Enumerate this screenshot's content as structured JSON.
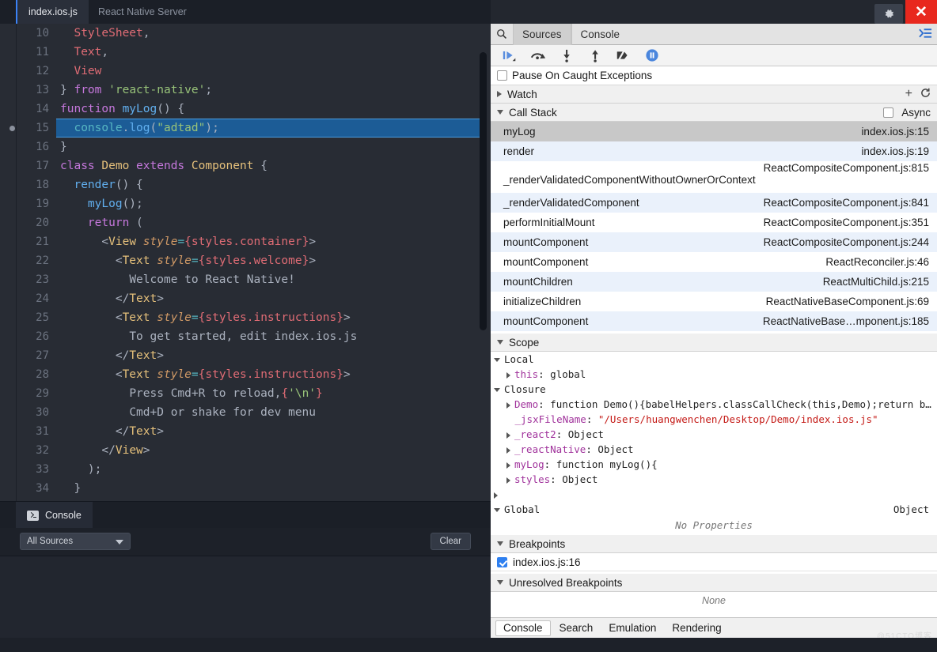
{
  "editor": {
    "tabs": [
      {
        "label": "index.ios.js",
        "active": true
      },
      {
        "label": "React Native Server",
        "active": false
      }
    ],
    "lines": [
      {
        "num": "10",
        "html": "  <span class='t-cls'>StyleSheet</span><span class='t-punc'>,</span>"
      },
      {
        "num": "11",
        "html": "  <span class='t-cls'>Text</span><span class='t-punc'>,</span>"
      },
      {
        "num": "12",
        "html": "  <span class='t-cls'>View</span>"
      },
      {
        "num": "13",
        "html": "<span class='t-punc'>} </span><span class='t-kw'>from</span> <span class='t-str'>'react-native'</span><span class='t-punc'>;</span>"
      },
      {
        "num": "14",
        "html": "<span class='t-kw'>function</span> <span class='t-fn'>myLog</span><span class='t-punc'>() {</span>"
      },
      {
        "num": "15",
        "html": "  <span class='t-obj'>console</span><span class='t-punc'>.</span><span class='t-fn'>log</span><span class='t-punc'>(</span><span class='t-str'>\"adtad\"</span><span class='t-punc'>);</span>",
        "highlight": true,
        "breakpoint": true
      },
      {
        "num": "16",
        "html": "<span class='t-punc'>}</span>"
      },
      {
        "num": "17",
        "html": "<span class='t-kw'>class</span> <span class='t-yellow'>Demo</span> <span class='t-kw'>extends</span> <span class='t-yellow'>Component</span> <span class='t-punc'>{</span>"
      },
      {
        "num": "18",
        "html": "  <span class='t-fn'>render</span><span class='t-punc'>() {</span>"
      },
      {
        "num": "19",
        "html": "    <span class='t-fn'>myLog</span><span class='t-punc'>();</span>"
      },
      {
        "num": "20",
        "html": "    <span class='t-kw'>return</span> <span class='t-punc'>(</span>"
      },
      {
        "num": "21",
        "html": "      <span class='t-punc'>&lt;</span><span class='t-yellow'>View</span> <span class='t-attr'>style</span><span class='t-obj'>=</span><span class='t-brace'>{</span><span class='t-red'>styles</span><span class='t-red'>.container</span><span class='t-brace'>}</span><span class='t-punc'>&gt;</span>"
      },
      {
        "num": "22",
        "html": "        <span class='t-punc'>&lt;</span><span class='t-yellow'>Text</span> <span class='t-attr'>style</span><span class='t-obj'>=</span><span class='t-brace'>{</span><span class='t-red'>styles.welcome</span><span class='t-brace'>}</span><span class='t-punc'>&gt;</span>"
      },
      {
        "num": "23",
        "html": "          <span class='t-def'>Welcome to React Native!</span>"
      },
      {
        "num": "24",
        "html": "        <span class='t-punc'>&lt;/</span><span class='t-yellow'>Text</span><span class='t-punc'>&gt;</span>"
      },
      {
        "num": "25",
        "html": "        <span class='t-punc'>&lt;</span><span class='t-yellow'>Text</span> <span class='t-attr'>style</span><span class='t-obj'>=</span><span class='t-brace'>{</span><span class='t-red'>styles.instructions</span><span class='t-brace'>}</span><span class='t-punc'>&gt;</span>"
      },
      {
        "num": "26",
        "html": "          <span class='t-def'>To get started, edit index.ios.js</span>"
      },
      {
        "num": "27",
        "html": "        <span class='t-punc'>&lt;/</span><span class='t-yellow'>Text</span><span class='t-punc'>&gt;</span>"
      },
      {
        "num": "28",
        "html": "        <span class='t-punc'>&lt;</span><span class='t-yellow'>Text</span> <span class='t-attr'>style</span><span class='t-obj'>=</span><span class='t-brace'>{</span><span class='t-red'>styles.instructions</span><span class='t-brace'>}</span><span class='t-punc'>&gt;</span>"
      },
      {
        "num": "29",
        "html": "          <span class='t-def'>Press Cmd+R to reload,</span><span class='t-brace'>{</span><span class='t-str'>'\\n'</span><span class='t-brace'>}</span>"
      },
      {
        "num": "30",
        "html": "          <span class='t-def'>Cmd+D or shake for dev menu</span>"
      },
      {
        "num": "31",
        "html": "        <span class='t-punc'>&lt;/</span><span class='t-yellow'>Text</span><span class='t-punc'>&gt;</span>"
      },
      {
        "num": "32",
        "html": "      <span class='t-punc'>&lt;/</span><span class='t-yellow'>View</span><span class='t-punc'>&gt;</span>"
      },
      {
        "num": "33",
        "html": "    <span class='t-punc'>);</span>"
      },
      {
        "num": "34",
        "html": "  <span class='t-punc'>}</span>"
      }
    ]
  },
  "left_console": {
    "tab_label": "Console",
    "source_filter": "All Sources",
    "clear_label": "Clear"
  },
  "devtools": {
    "tabs": [
      {
        "label": "Sources",
        "active": true
      },
      {
        "label": "Console",
        "active": false
      }
    ],
    "controls": [
      "resume-script-execution",
      "step-over-next-function-call",
      "step-into-next-function-call",
      "step-out-of-current-function",
      "deactivate-breakpoints",
      "pause-on-exceptions"
    ],
    "pause_on_caught_exceptions": {
      "label": "Pause On Caught Exceptions",
      "checked": false
    },
    "watch": {
      "label": "Watch",
      "expanded": false
    },
    "call_stack": {
      "label": "Call Stack",
      "expanded": true,
      "async_label": "Async",
      "async_checked": false,
      "frames": [
        {
          "fn": "myLog",
          "loc": "index.ios.js:15",
          "state": "selected"
        },
        {
          "fn": "render",
          "loc": "index.ios.js:19",
          "state": "alt"
        },
        {
          "fn": "_renderValidatedComponentWithoutOwnerOrContext",
          "loc": "ReactCompositeComponent.js:815",
          "state": "plain",
          "wrap": true
        },
        {
          "fn": "_renderValidatedComponent",
          "loc": "ReactCompositeComponent.js:841",
          "state": "alt"
        },
        {
          "fn": "performInitialMount",
          "loc": "ReactCompositeComponent.js:351",
          "state": "plain"
        },
        {
          "fn": "mountComponent",
          "loc": "ReactCompositeComponent.js:244",
          "state": "alt"
        },
        {
          "fn": "mountComponent",
          "loc": "ReactReconciler.js:46",
          "state": "plain"
        },
        {
          "fn": "mountChildren",
          "loc": "ReactMultiChild.js:215",
          "state": "alt"
        },
        {
          "fn": "initializeChildren",
          "loc": "ReactNativeBaseComponent.js:69",
          "state": "plain"
        },
        {
          "fn": "mountComponent",
          "loc": "ReactNativeBase…mponent.js:185",
          "state": "alt"
        }
      ]
    },
    "scope": {
      "label": "Scope",
      "expanded": true,
      "groups": [
        {
          "label": "Local",
          "expanded": true,
          "entries": [
            {
              "arrow": "right",
              "name": "this",
              "sep": ": ",
              "value": "global",
              "value_type": "plain",
              "indent": 1
            }
          ]
        },
        {
          "label": "Closure",
          "expanded": true,
          "entries": [
            {
              "arrow": "right",
              "name": "Demo",
              "sep": ": ",
              "value": "function Demo(){babelHelpers.classCallCheck(this,Demo);return b…",
              "value_type": "plain",
              "indent": 1
            },
            {
              "arrow": "none",
              "name": "_jsxFileName",
              "sep": ": ",
              "value": "\"/Users/huangwenchen/Desktop/Demo/index.ios.js\"",
              "value_type": "string",
              "indent": 1
            },
            {
              "arrow": "right",
              "name": "_react2",
              "sep": ": ",
              "value": "Object",
              "value_type": "plain",
              "indent": 1
            },
            {
              "arrow": "right",
              "name": "_reactNative",
              "sep": ": ",
              "value": "Object",
              "value_type": "plain",
              "indent": 1
            },
            {
              "arrow": "right",
              "name": "myLog",
              "sep": ": ",
              "value": "function myLog(){",
              "value_type": "plain",
              "indent": 1
            },
            {
              "arrow": "right",
              "name": "styles",
              "sep": ": ",
              "value": "Object",
              "value_type": "plain",
              "indent": 1
            }
          ]
        },
        {
          "label": "",
          "expanded": false,
          "entries": []
        },
        {
          "label": "Global",
          "expanded": true,
          "right_value": "Object",
          "entries": [],
          "empty_text": "No Properties"
        }
      ]
    },
    "breakpoints": {
      "label": "Breakpoints",
      "expanded": true,
      "items": [
        {
          "label": "index.ios.js:16",
          "checked": true
        }
      ]
    },
    "unresolved_breakpoints": {
      "label": "Unresolved Breakpoints",
      "expanded": true,
      "empty_text": "None"
    },
    "drawer_tabs": [
      {
        "label": "Console",
        "active": true
      },
      {
        "label": "Search",
        "active": false
      },
      {
        "label": "Emulation",
        "active": false
      },
      {
        "label": "Rendering",
        "active": false
      }
    ]
  },
  "window": {
    "settings_icon": "gear-icon",
    "close_icon": "close-icon"
  },
  "watermark": "@51CTO博客",
  "colors": {
    "editor_bg": "#282c34",
    "highlight_blue": "#1c5c96",
    "accent_blue": "#3b82f6",
    "close_red": "#e8281e",
    "devtools_bg": "#ffffff",
    "selected_row": "#c8c8c8",
    "alt_row": "#eaf1fb"
  }
}
